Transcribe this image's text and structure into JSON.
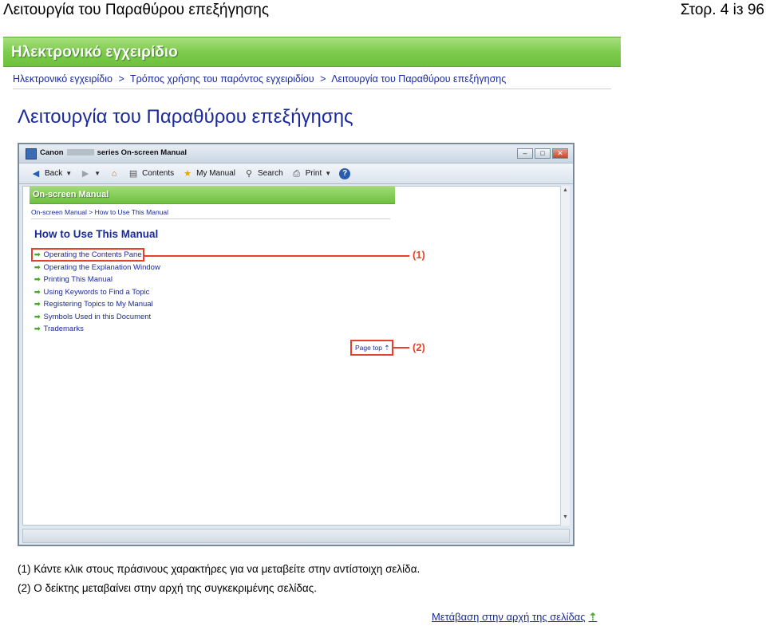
{
  "header": {
    "title": "Λειτουργία του Παραθύρου επεξήγησης",
    "page_number": "Στορ. 4 із 96"
  },
  "banner": {
    "text": "Ηλεκτρονικό εγχειρίδιο"
  },
  "breadcrumb": {
    "items": [
      "Ηλεκτρονικό εγχειρίδιο",
      "Τρόπος χρήσης του παρόντος εγχειριδίου",
      "Λειτουργία του Παραθύρου επεξήγησης"
    ],
    "separator": ">"
  },
  "heading": "Λειτουργία του Παραθύρου επεξήγησης",
  "screenshot": {
    "window_title_prefix": "Canon",
    "window_title_suffix": "series On-screen Manual",
    "toolbar": {
      "back": "Back",
      "contents": "Contents",
      "my_manual": "My Manual",
      "search": "Search",
      "print": "Print"
    },
    "inner_banner": "On-screen Manual",
    "inner_breadcrumb": "On-screen Manual > How to Use This Manual",
    "inner_heading": "How to Use This Manual",
    "links": [
      "Operating the Contents Pane",
      "Operating the Explanation Window",
      "Printing This Manual",
      "Using Keywords to Find a Topic",
      "Registering Topics to My Manual",
      "Symbols Used in this Document",
      "Trademarks"
    ],
    "page_top": "Page top",
    "callout_1": "(1)",
    "callout_2": "(2)"
  },
  "notes": [
    "(1) Κάντε κλικ στους πράσινους χαρακτήρες για να μεταβείτε στην αντίστοιχη σελίδα.",
    "(2) Ο δείκτης μεταβαίνει στην αρχή της συγκεκριμένης σελίδας."
  ],
  "goto_top": "Μετάβαση στην αρχή της σελίδας",
  "colors": {
    "link": "#1a2a9a",
    "banner_green": "#7fcc4e",
    "callout_red": "#e8402a"
  }
}
